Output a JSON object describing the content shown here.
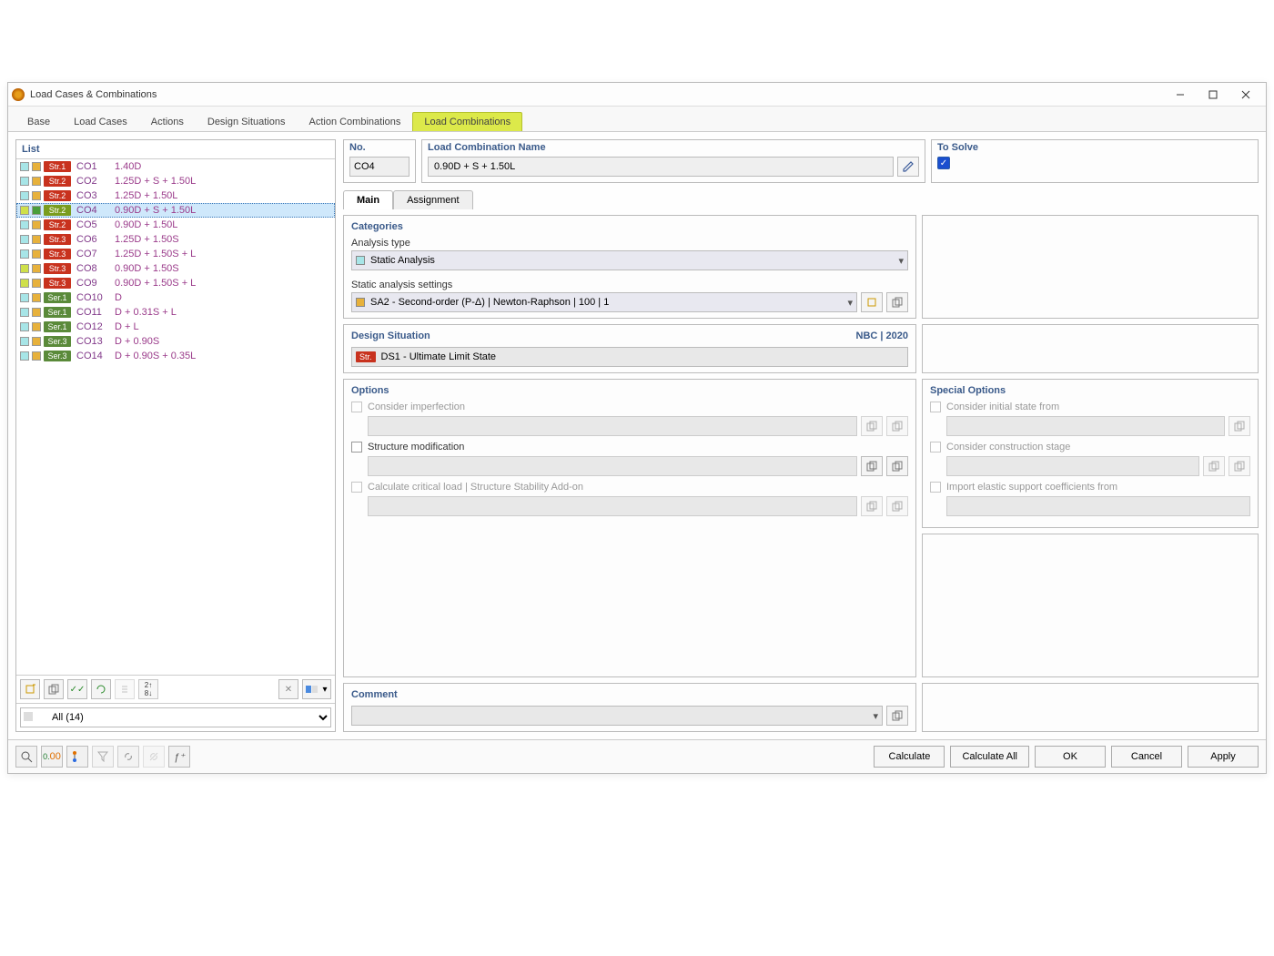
{
  "window": {
    "title": "Load Cases & Combinations"
  },
  "tabs": [
    "Base",
    "Load Cases",
    "Actions",
    "Design Situations",
    "Action Combinations",
    "Load Combinations"
  ],
  "active_tab": 5,
  "list": {
    "header": "List",
    "filter": "All (14)",
    "rows": [
      {
        "sw": [
          "#a7e5e7",
          "#e7b13b"
        ],
        "cat": "Str.1",
        "catCls": "str1",
        "co": "CO1",
        "formula": "1.40D",
        "sel": false,
        "hl": false
      },
      {
        "sw": [
          "#a7e5e7",
          "#e7b13b"
        ],
        "cat": "Str.2",
        "catCls": "str2",
        "co": "CO2",
        "formula": "1.25D + S + 1.50L",
        "sel": false,
        "hl": false
      },
      {
        "sw": [
          "#a7e5e7",
          "#e7b13b"
        ],
        "cat": "Str.2",
        "catCls": "str2",
        "co": "CO3",
        "formula": "1.25D + 1.50L",
        "sel": false,
        "hl": false
      },
      {
        "sw": [
          "#cfe04a",
          "#4a9e3b"
        ],
        "cat": "Str.2",
        "catCls": "sel",
        "co": "CO4",
        "formula": "0.90D + S + 1.50L",
        "sel": true,
        "hl": true
      },
      {
        "sw": [
          "#a7e5e7",
          "#e7b13b"
        ],
        "cat": "Str.2",
        "catCls": "str2",
        "co": "CO5",
        "formula": "0.90D + 1.50L",
        "sel": false,
        "hl": true
      },
      {
        "sw": [
          "#a7e5e7",
          "#e7b13b"
        ],
        "cat": "Str.3",
        "catCls": "str3",
        "co": "CO6",
        "formula": "1.25D + 1.50S",
        "sel": false,
        "hl": false
      },
      {
        "sw": [
          "#a7e5e7",
          "#e7b13b"
        ],
        "cat": "Str.3",
        "catCls": "str3",
        "co": "CO7",
        "formula": "1.25D + 1.50S + L",
        "sel": false,
        "hl": false
      },
      {
        "sw": [
          "#cfe04a",
          "#e7b13b"
        ],
        "cat": "Str.3",
        "catCls": "str3",
        "co": "CO8",
        "formula": "0.90D + 1.50S",
        "sel": false,
        "hl": true
      },
      {
        "sw": [
          "#cfe04a",
          "#e7b13b"
        ],
        "cat": "Str.3",
        "catCls": "str3",
        "co": "CO9",
        "formula": "0.90D + 1.50S + L",
        "sel": false,
        "hl": true
      },
      {
        "sw": [
          "#a7e5e7",
          "#e7b13b"
        ],
        "cat": "Ser.1",
        "catCls": "ser1",
        "co": "CO10",
        "formula": "D",
        "sel": false,
        "hl": false
      },
      {
        "sw": [
          "#a7e5e7",
          "#e7b13b"
        ],
        "cat": "Ser.1",
        "catCls": "ser1",
        "co": "CO11",
        "formula": "D + 0.31S + L",
        "sel": false,
        "hl": false
      },
      {
        "sw": [
          "#a7e5e7",
          "#e7b13b"
        ],
        "cat": "Ser.1",
        "catCls": "ser1",
        "co": "CO12",
        "formula": "D + L",
        "sel": false,
        "hl": false
      },
      {
        "sw": [
          "#a7e5e7",
          "#e7b13b"
        ],
        "cat": "Ser.3",
        "catCls": "ser3",
        "co": "CO13",
        "formula": "D + 0.90S",
        "sel": false,
        "hl": false
      },
      {
        "sw": [
          "#a7e5e7",
          "#e7b13b"
        ],
        "cat": "Ser.3",
        "catCls": "ser3",
        "co": "CO14",
        "formula": "D + 0.90S + 0.35L",
        "sel": false,
        "hl": false
      }
    ]
  },
  "detail": {
    "no_label": "No.",
    "no": "CO4",
    "name_label": "Load Combination Name",
    "name": "0.90D + S + 1.50L",
    "solve_label": "To Solve",
    "solve": true,
    "inner_tabs": [
      "Main",
      "Assignment"
    ],
    "inner_active": 0,
    "categories": {
      "title": "Categories",
      "analysis_label": "Analysis type",
      "analysis_value": "Static Analysis",
      "sa_label": "Static analysis settings",
      "sa_value": "SA2 - Second-order (P-Δ) | Newton-Raphson | 100 | 1",
      "sa_sw": "#e7b13b"
    },
    "ds": {
      "title": "Design Situation",
      "code": "NBC | 2020",
      "tag": "Str.",
      "text": "DS1 - Ultimate Limit State"
    },
    "options": {
      "title": "Options",
      "items": [
        {
          "label": "Consider imperfection",
          "enabled": false,
          "checked": false,
          "hasInput": true,
          "btns": 2
        },
        {
          "label": "Structure modification",
          "enabled": true,
          "checked": false,
          "hasInput": true,
          "btns": 2
        },
        {
          "label": "Calculate critical load | Structure Stability Add-on",
          "enabled": false,
          "checked": false,
          "hasInput": true,
          "btns": 2
        }
      ]
    },
    "special": {
      "title": "Special Options",
      "items": [
        {
          "label": "Consider initial state from",
          "enabled": false,
          "checked": false,
          "hasInput": true,
          "btns": 1
        },
        {
          "label": "Consider construction stage",
          "enabled": false,
          "checked": false,
          "hasInput": true,
          "btns": 2
        },
        {
          "label": "Import elastic support coefficients from",
          "enabled": false,
          "checked": false,
          "hasInput": true,
          "btns": 0
        }
      ]
    },
    "comment": {
      "title": "Comment"
    }
  },
  "footer": {
    "buttons": [
      "Calculate",
      "Calculate All",
      "OK",
      "Cancel",
      "Apply"
    ]
  }
}
